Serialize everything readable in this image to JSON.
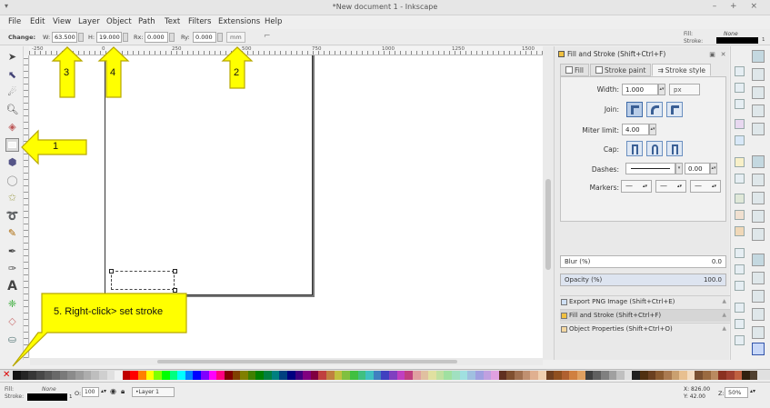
{
  "window": {
    "title": "*New document 1 - Inkscape",
    "controls": "– + ×"
  },
  "menu": [
    "File",
    "Edit",
    "View",
    "Layer",
    "Object",
    "Path",
    "Text",
    "Filters",
    "Extensions",
    "Help"
  ],
  "controls_bar": {
    "change_label": "Change:",
    "w_label": "W:",
    "w_value": "63.500",
    "h_label": "H:",
    "h_value": "19.000",
    "rx_label": "Rx:",
    "rx_value": "0.000",
    "ry_label": "Ry:",
    "ry_value": "0.000",
    "unit": "mm",
    "fill_label": "Fill:",
    "stroke_label": "Stroke:",
    "fill_value": "None",
    "stroke_width": "1"
  },
  "ruler": {
    "ticks": [
      "-250",
      "0",
      "250",
      "500",
      "750",
      "1000",
      "1250",
      "1500"
    ]
  },
  "panel": {
    "title": "Fill and Stroke (Shift+Ctrl+F)",
    "tabs": [
      "Fill",
      "Stroke paint",
      "Stroke style"
    ],
    "width_label": "Width:",
    "width_value": "1.000",
    "width_unit": "px",
    "join_label": "Join:",
    "miter_label": "Miter limit:",
    "miter_value": "4.00",
    "cap_label": "Cap:",
    "dashes_label": "Dashes:",
    "dash_offset": "0.00",
    "markers_label": "Markers:",
    "marker_symbol": "—",
    "blur_label": "Blur (%)",
    "blur_value": "0.0",
    "opacity_label": "Opacity (%)",
    "opacity_value": "100.0",
    "sections": [
      "Export PNG Image (Shift+Ctrl+E)",
      "Fill and Stroke (Shift+Ctrl+F)",
      "Object Properties (Shift+Ctrl+O)"
    ]
  },
  "status": {
    "fill_label": "Fill:",
    "stroke_label": "Stroke:",
    "fill_value": "None",
    "stroke_width": "1",
    "opacity_label": "O:",
    "opacity_value": "100",
    "layer": "•Layer 1",
    "x_coord": "X:  826.00",
    "y_coord": "Y:   42.00",
    "zoom_label": "Z:",
    "zoom_value": "50%"
  },
  "annotations": {
    "a1": "1",
    "a2": "2",
    "a3": "3",
    "a4": "4",
    "a5": "5. Right-click> set stroke"
  },
  "colors": {
    "callout_fill": "#ffff00",
    "callout_stroke": "#b8a800"
  }
}
